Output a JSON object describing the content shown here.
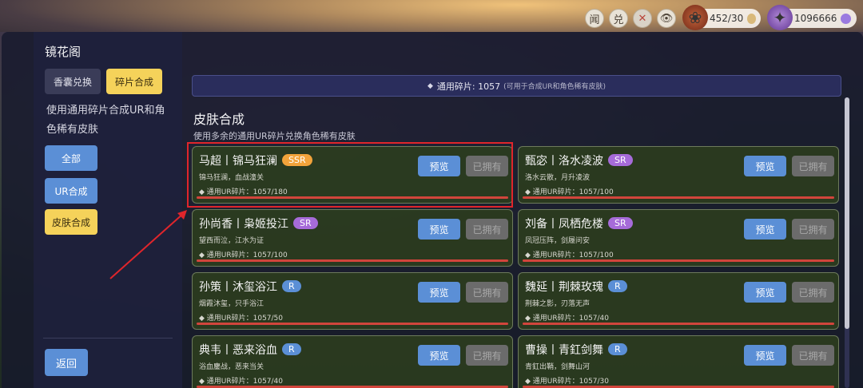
{
  "topbar": {
    "btn1": "闻",
    "btn2": "兑",
    "btn3": "✕",
    "btn4": "👁",
    "resource1": "452/30",
    "resource2": "1096666"
  },
  "sidebar": {
    "title": "镜花阁",
    "tab_exchange": "香囊兑换",
    "tab_synthesis": "碎片合成",
    "description": "使用通用碎片合成UR和角色稀有皮肤",
    "filter_all": "全部",
    "filter_ur": "UR合成",
    "filter_skin": "皮肤合成",
    "back": "返回"
  },
  "banner": {
    "text": "通用碎片: 1057",
    "note": "(可用于合成UR和角色稀有皮肤)"
  },
  "section": {
    "title": "皮肤合成",
    "subtitle": "使用多余的通用UR碎片兑换角色稀有皮肤"
  },
  "labels": {
    "preview": "预览",
    "owned": "已拥有"
  },
  "cards": [
    {
      "name": "马超丨锦马狂澜",
      "rarity": "SSR",
      "desc": "锦马狂澜，血战潼关",
      "progress": "◆ 通用UR碎片：1057/180",
      "fill": 1.0
    },
    {
      "name": "甄宓丨洛水凌波",
      "rarity": "SR",
      "desc": "洛水云散，月升凌波",
      "progress": "◆ 通用UR碎片：1057/100",
      "fill": 1.0
    },
    {
      "name": "孙尚香丨枭姬投江",
      "rarity": "SR",
      "desc": "望西而泣，江水为证",
      "progress": "◆ 通用UR碎片：1057/100",
      "fill": 1.0
    },
    {
      "name": "刘备丨凤栖危楼",
      "rarity": "SR",
      "desc": "凤冠压阵，剑履问安",
      "progress": "◆ 通用UR碎片：1057/100",
      "fill": 1.0
    },
    {
      "name": "孙策丨沐玺浴江",
      "rarity": "R",
      "desc": "烟霞沐玺，只手浴江",
      "progress": "◆ 通用UR碎片：1057/50",
      "fill": 1.0
    },
    {
      "name": "魏延丨荆棘玫瑰",
      "rarity": "R",
      "desc": "荆棘之影，刃落无声",
      "progress": "◆ 通用UR碎片：1057/40",
      "fill": 1.0
    },
    {
      "name": "典韦丨恶来浴血",
      "rarity": "R",
      "desc": "浴血鏖战，恶来当关",
      "progress": "◆ 通用UR碎片：1057/40",
      "fill": 1.0
    },
    {
      "name": "曹操丨青釭剑舞",
      "rarity": "R",
      "desc": "青釭出鞘，剑舞山河",
      "progress": "◆ 通用UR碎片：1057/30",
      "fill": 1.0
    }
  ]
}
